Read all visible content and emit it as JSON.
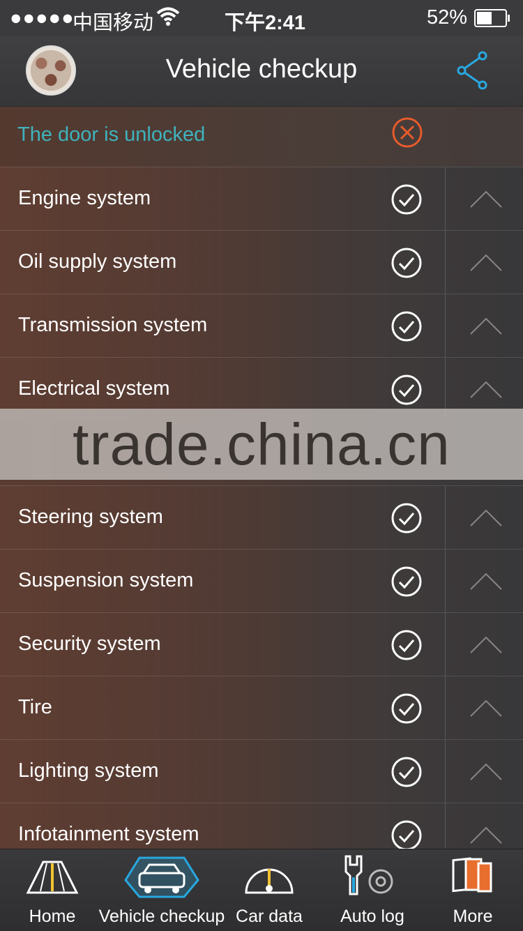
{
  "status_bar": {
    "signal": "●●●●●",
    "carrier": "中国移动",
    "time": "下午2:41",
    "battery_percent": "52%"
  },
  "header": {
    "title": "Vehicle checkup"
  },
  "door_status": {
    "text": "The door is unlocked",
    "status": "error",
    "color": "#3fb3bd",
    "icon_color": "#e65b2c"
  },
  "systems": [
    {
      "label": "Engine system",
      "status": "ok"
    },
    {
      "label": "Oil supply system",
      "status": "ok"
    },
    {
      "label": "Transmission system",
      "status": "ok"
    },
    {
      "label": "Electrical system",
      "status": "ok"
    },
    {
      "label": "Steering system",
      "status": "ok"
    },
    {
      "label": "Suspension system",
      "status": "ok"
    },
    {
      "label": "Security system",
      "status": "ok"
    },
    {
      "label": "Tire",
      "status": "ok"
    },
    {
      "label": "Lighting system",
      "status": "ok"
    },
    {
      "label": "Infotainment system",
      "status": "ok"
    }
  ],
  "watermark": "trade.china.cn",
  "tabs": [
    {
      "label": "Home",
      "icon": "road-icon",
      "active": false
    },
    {
      "label": "Vehicle checkup",
      "icon": "car-icon",
      "active": true
    },
    {
      "label": "Car data",
      "icon": "gauge-icon",
      "active": false
    },
    {
      "label": "Auto log",
      "icon": "wrench-wheel-icon",
      "active": false
    },
    {
      "label": "More",
      "icon": "cards-icon",
      "active": false
    }
  ]
}
